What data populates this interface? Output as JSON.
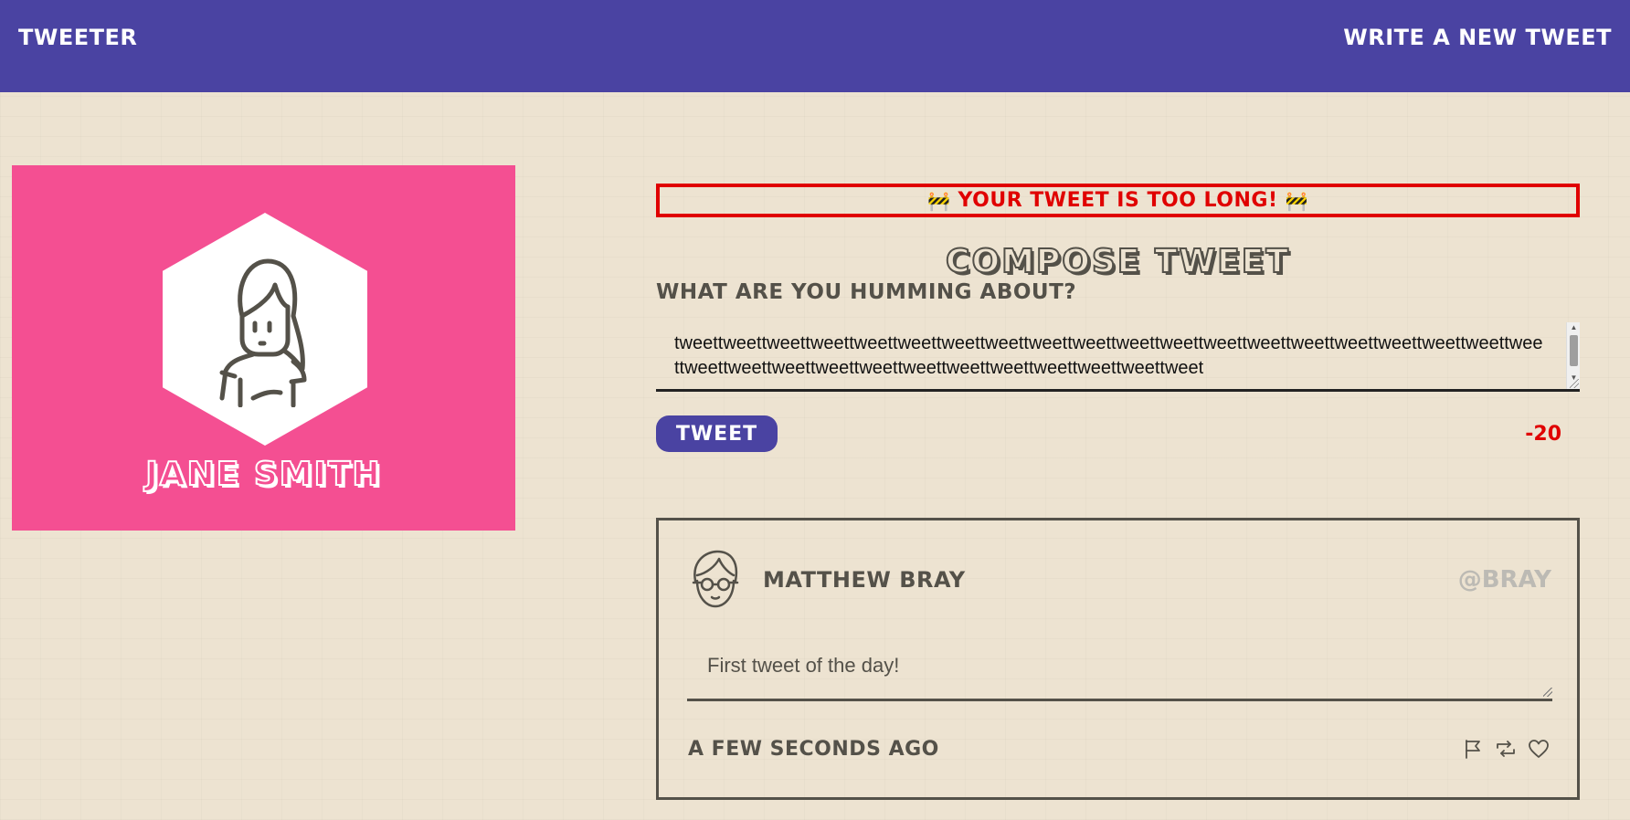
{
  "nav": {
    "brand": "TWEETER",
    "compose_link": "WRITE A NEW TWEET"
  },
  "profile": {
    "name": "JANE SMITH",
    "avatar_icon": "woman-avatar-icon",
    "card_color": "#f44f92"
  },
  "compose": {
    "error_message": "YOUR TWEET IS TOO LONG!",
    "error_icon": "🚧",
    "title": "COMPOSE TWEET",
    "prompt": "WHAT ARE YOU HUMMING ABOUT?",
    "text_value": "tweettweettweettweettweettweettweettweettweettweettweettweettweettweettweettweettweettweettweettweettweettweettweettweettweettweettweettweettweettweettweettweet",
    "submit_label": "TWEET",
    "counter": "-20"
  },
  "tweets": [
    {
      "author": "MATTHEW BRAY",
      "handle": "@BRAY",
      "avatar_icon": "man-with-glasses-avatar-icon",
      "body": "First tweet of the day!",
      "timestamp": "A FEW SECONDS AGO",
      "actions": [
        "flag-icon",
        "retweet-icon",
        "heart-icon"
      ]
    }
  ],
  "colors": {
    "nav": "#4a43a2",
    "background": "#ede3d1",
    "error": "#e00000",
    "text": "#545149",
    "handle": "#bcbab4"
  }
}
